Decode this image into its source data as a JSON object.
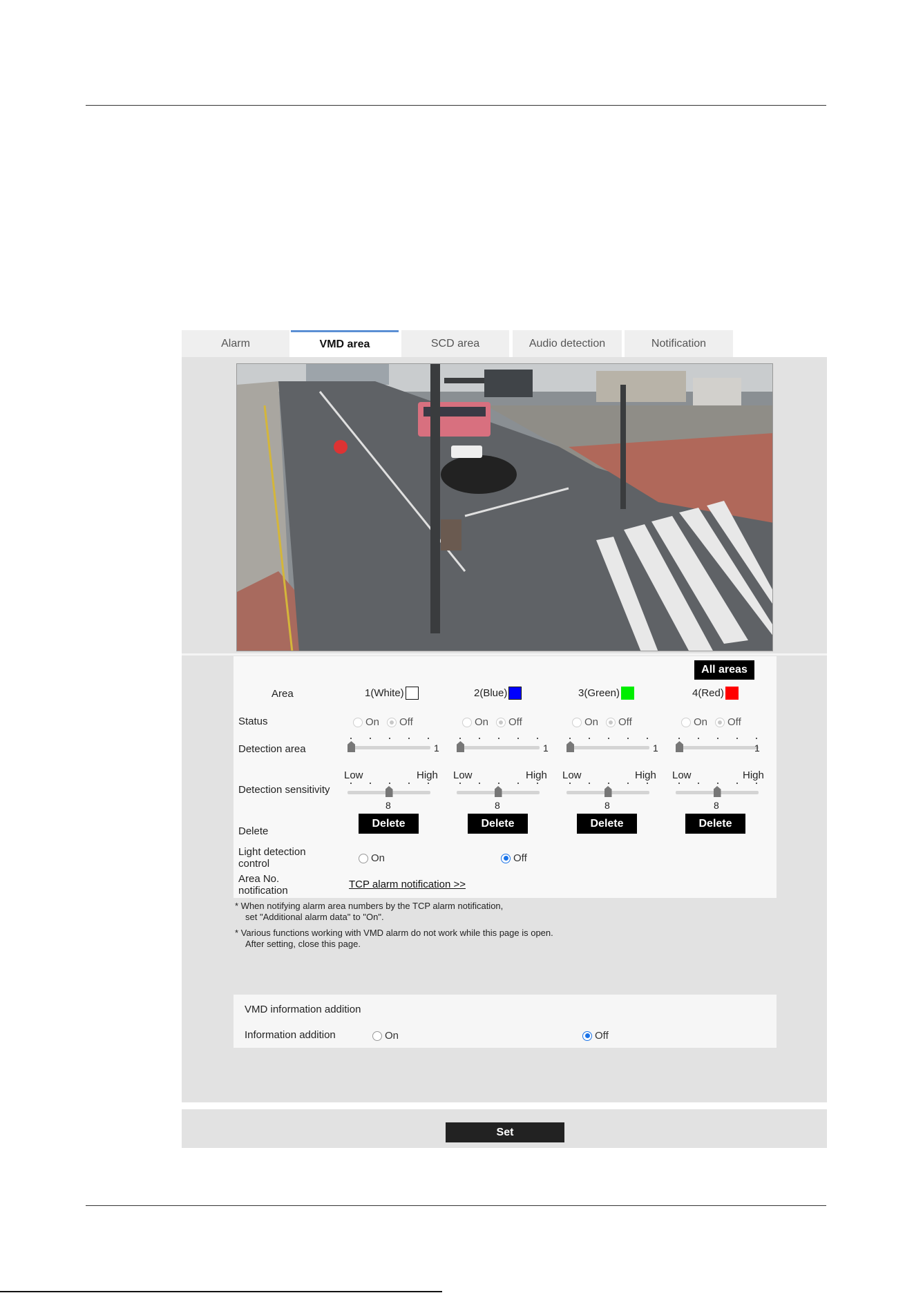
{
  "tabs": [
    {
      "label": "Alarm",
      "active": false
    },
    {
      "label": "VMD area",
      "active": true
    },
    {
      "label": "SCD area",
      "active": false
    },
    {
      "label": "Audio detection",
      "active": false
    },
    {
      "label": "Notification",
      "active": false
    }
  ],
  "camera_view": {
    "alt": "Live camera image of a street intersection"
  },
  "settings": {
    "all_areas_label": "All areas",
    "area_label": "Area",
    "status_label": "Status",
    "detection_area_label": "Detection area",
    "detection_sensitivity_label": "Detection sensitivity",
    "delete_label": "Delete",
    "light_detection_label": "Light detection control",
    "area_no_label": "Area No. notification",
    "low_label": "Low",
    "high_label": "High",
    "on_label": "On",
    "off_label": "Off",
    "delete_button": "Delete",
    "tcp_link": "TCP alarm notification >>",
    "light_detection_value": "Off",
    "areas": [
      {
        "name": "1(White)",
        "color": "#ffffff",
        "status": "Off",
        "detection_area": "1",
        "detection_area_level": 0,
        "sensitivity": "8",
        "sensitivity_level": 0.5
      },
      {
        "name": "2(Blue)",
        "color": "#0000ff",
        "status": "Off",
        "detection_area": "1",
        "detection_area_level": 0,
        "sensitivity": "8",
        "sensitivity_level": 0.5
      },
      {
        "name": "3(Green)",
        "color": "#00ee00",
        "status": "Off",
        "detection_area": "1",
        "detection_area_level": 0,
        "sensitivity": "8",
        "sensitivity_level": 0.5
      },
      {
        "name": "4(Red)",
        "color": "#ff0000",
        "status": "Off",
        "detection_area": "1",
        "detection_area_level": 0,
        "sensitivity": "8",
        "sensitivity_level": 0.5
      }
    ]
  },
  "notes": {
    "note1_line1": "* When notifying alarm area numbers by the TCP alarm notification,",
    "note1_line2": "set \"Additional alarm data\" to \"On\".",
    "note2_line1": "* Various functions working with VMD alarm do not work while this page is open.",
    "note2_line2": "After setting, close this page."
  },
  "vmd_info": {
    "title": "VMD information addition",
    "field_label": "Information addition",
    "on_label": "On",
    "off_label": "Off",
    "value": "Off"
  },
  "set_button": "Set"
}
